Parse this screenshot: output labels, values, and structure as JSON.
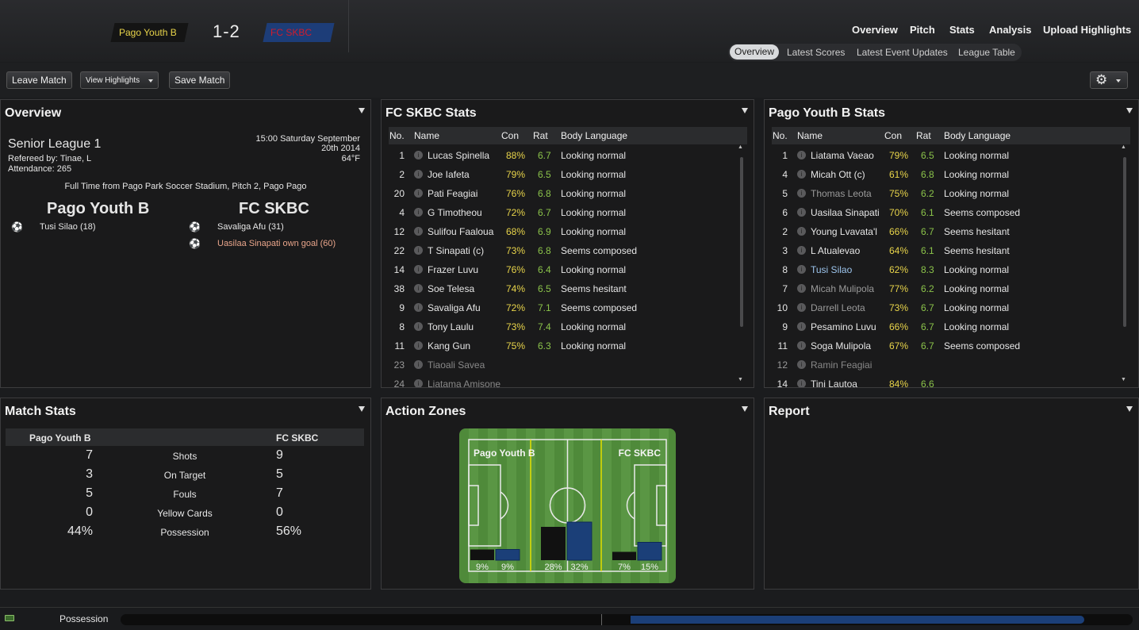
{
  "header": {
    "home_team": "Pago Youth B",
    "score": "1-2",
    "away_team": "FC SKBC"
  },
  "nav": {
    "items": [
      "Overview",
      "Pitch",
      "Stats",
      "Analysis",
      "Upload Highlights"
    ],
    "sub_items": [
      "Overview",
      "Latest Scores",
      "Latest Event Updates",
      "League Table"
    ],
    "active_sub": "Overview"
  },
  "toolbar": {
    "leave": "Leave Match",
    "highlights": "View Highlights",
    "save": "Save Match"
  },
  "overview": {
    "title": "Overview",
    "competition": "Senior League 1",
    "referee": "Refereed by: Tinae, L",
    "attendance": "Attendance: 265",
    "time_line1": "15:00 Saturday September",
    "time_line2": "20th 2014",
    "temp": "64°F",
    "venue": "Full Time from Pago Park Soccer Stadium, Pitch 2, Pago Pago",
    "home": "Pago Youth B",
    "away": "FC SKBC",
    "home_goals": [
      "Tusi Silao (18)"
    ],
    "away_goals": [
      "Savaliga Afu (31)",
      "Uasilaa Sinapati own goal (60)"
    ]
  },
  "stats_headers": {
    "no": "No.",
    "name": "Name",
    "con": "Con",
    "rat": "Rat",
    "body": "Body Language"
  },
  "skbc": {
    "title": "FC SKBC Stats",
    "rows": [
      [
        "1",
        "Lucas Spinella",
        "88%",
        "6.7",
        "Looking normal"
      ],
      [
        "2",
        "Joe Iafeta",
        "79%",
        "6.5",
        "Looking normal"
      ],
      [
        "20",
        "Pati Feagiai",
        "76%",
        "6.8",
        "Looking normal"
      ],
      [
        "4",
        "G Timotheou",
        "72%",
        "6.7",
        "Looking normal"
      ],
      [
        "12",
        "Sulifou Faaloua",
        "68%",
        "6.9",
        "Looking normal"
      ],
      [
        "22",
        "T Sinapati (c)",
        "73%",
        "6.8",
        "Seems composed"
      ],
      [
        "14",
        "Frazer Luvu",
        "76%",
        "6.4",
        "Looking normal"
      ],
      [
        "38",
        "Soe Telesa",
        "74%",
        "6.5",
        "Seems hesitant"
      ],
      [
        "9",
        "Savaliga Afu",
        "72%",
        "7.1",
        "Seems composed"
      ],
      [
        "8",
        "Tony Laulu",
        "73%",
        "7.4",
        "Looking normal"
      ],
      [
        "11",
        "Kang Gun",
        "75%",
        "6.3",
        "Looking normal"
      ],
      [
        "23",
        "Tiaoali Savea",
        "",
        "",
        ""
      ],
      [
        "24",
        "Liatama Amisone",
        "",
        "",
        ""
      ]
    ]
  },
  "pago": {
    "title": "Pago Youth B Stats",
    "rows": [
      [
        "1",
        "Liatama Vaeao",
        "79%",
        "6.5",
        "Looking normal"
      ],
      [
        "4",
        "Micah Ott (c)",
        "61%",
        "6.8",
        "Looking normal"
      ],
      [
        "5",
        "Thomas Leota",
        "75%",
        "6.2",
        "Looking normal"
      ],
      [
        "6",
        "Uasilaa Sinapati",
        "70%",
        "6.1",
        "Seems composed"
      ],
      [
        "2",
        "Young Lvavata'l",
        "66%",
        "6.7",
        "Seems hesitant"
      ],
      [
        "3",
        "L Atualevao",
        "64%",
        "6.1",
        "Seems hesitant"
      ],
      [
        "8",
        "Tusi Silao",
        "62%",
        "8.3",
        "Looking normal"
      ],
      [
        "7",
        "Micah Mulipola",
        "77%",
        "6.2",
        "Looking normal"
      ],
      [
        "10",
        "Darrell Leota",
        "73%",
        "6.7",
        "Looking normal"
      ],
      [
        "9",
        "Pesamino Luvu",
        "66%",
        "6.7",
        "Looking normal"
      ],
      [
        "11",
        "Soga Mulipola",
        "67%",
        "6.7",
        "Seems composed"
      ],
      [
        "12",
        "Ramin Feagiai",
        "",
        "",
        ""
      ],
      [
        "14",
        "Tini Lautoa",
        "84%",
        "6.6",
        ""
      ]
    ]
  },
  "match_stats": {
    "title": "Match Stats",
    "home": "Pago Youth B",
    "away": "FC SKBC",
    "rows": [
      [
        "7",
        "Shots",
        "9"
      ],
      [
        "3",
        "On Target",
        "5"
      ],
      [
        "5",
        "Fouls",
        "7"
      ],
      [
        "0",
        "Yellow Cards",
        "0"
      ],
      [
        "44%",
        "Possession",
        "56%"
      ]
    ]
  },
  "action_zones": {
    "title": "Action Zones",
    "home": "Pago Youth B",
    "away": "FC SKBC",
    "zones": [
      {
        "home": 9,
        "away": 9,
        "home_label": "9%",
        "away_label": "9%"
      },
      {
        "home": 28,
        "away": 32,
        "home_label": "28%",
        "away_label": "32%"
      },
      {
        "home": 7,
        "away": 15,
        "home_label": "7%",
        "away_label": "15%"
      }
    ]
  },
  "report": {
    "title": "Report"
  },
  "possession_bar": {
    "label": "Possession",
    "home": 44,
    "away": 56
  },
  "colors": {
    "home": "#111111",
    "away": "#1b3f78",
    "rating": "#8bc34a",
    "con": "#e8d44a"
  }
}
